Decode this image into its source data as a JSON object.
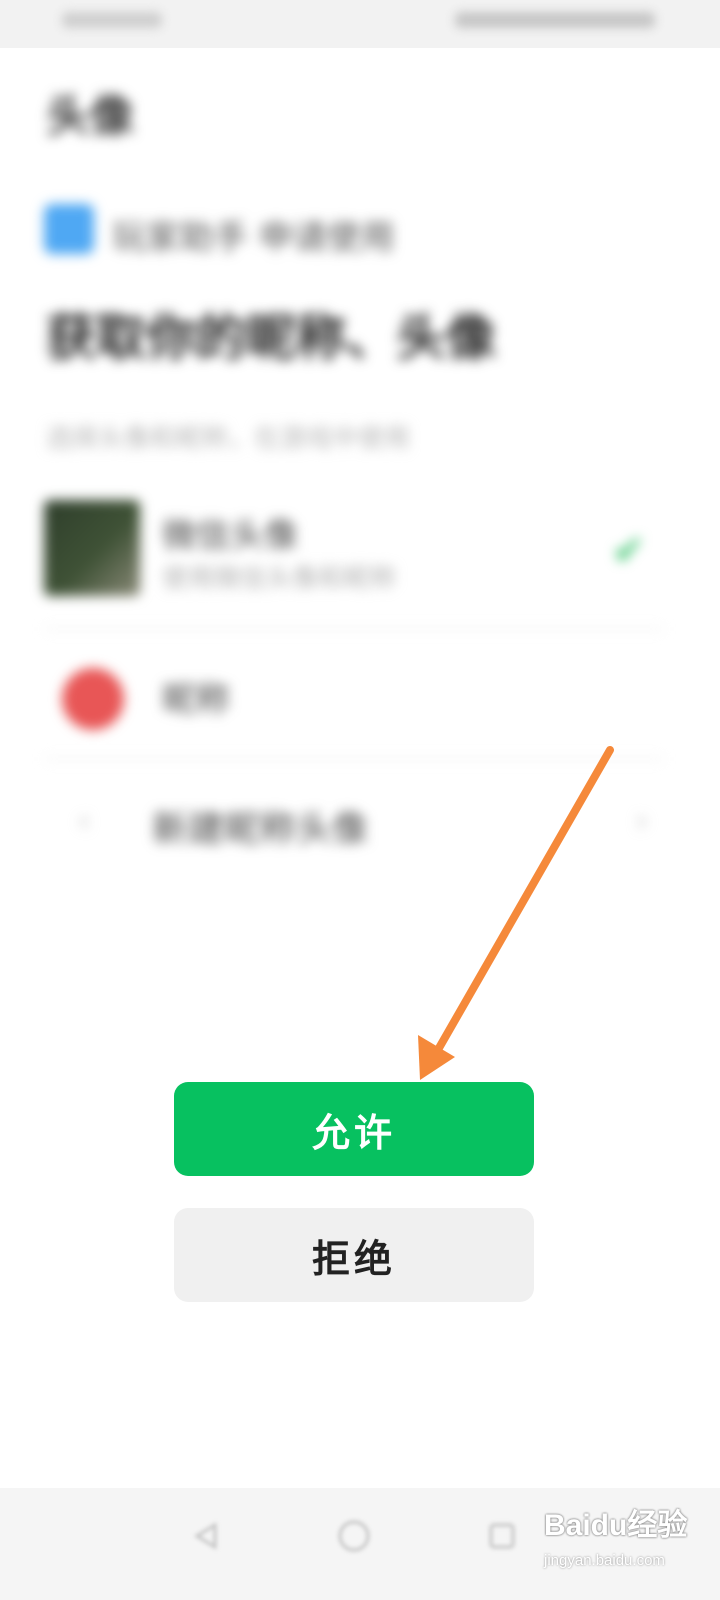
{
  "screen": {
    "page_title": "头像",
    "app_name": "玩家助手 申请使用",
    "request_heading": "获取你的昵称、头像",
    "description": "选择头像和昵称，在游戏中使用",
    "options": [
      {
        "name": "微信头像",
        "sub": "使用微信头像和昵称",
        "selected": true
      },
      {
        "name": "昵称",
        "sub": "",
        "selected": false
      }
    ],
    "new_profile_label": "新建昵称头像"
  },
  "buttons": {
    "allow_label": "允许",
    "deny_label": "拒绝"
  },
  "nav": {
    "back_icon": "triangle-back-icon",
    "home_icon": "circle-home-icon",
    "recent_icon": "square-recent-icon"
  },
  "watermark": {
    "brand": "Baidu经验",
    "sub": "jingyan.baidu.com"
  },
  "colors": {
    "allow_green": "#07c160",
    "deny_gray": "#f0f0f0",
    "arrow_orange": "#f5893a"
  }
}
